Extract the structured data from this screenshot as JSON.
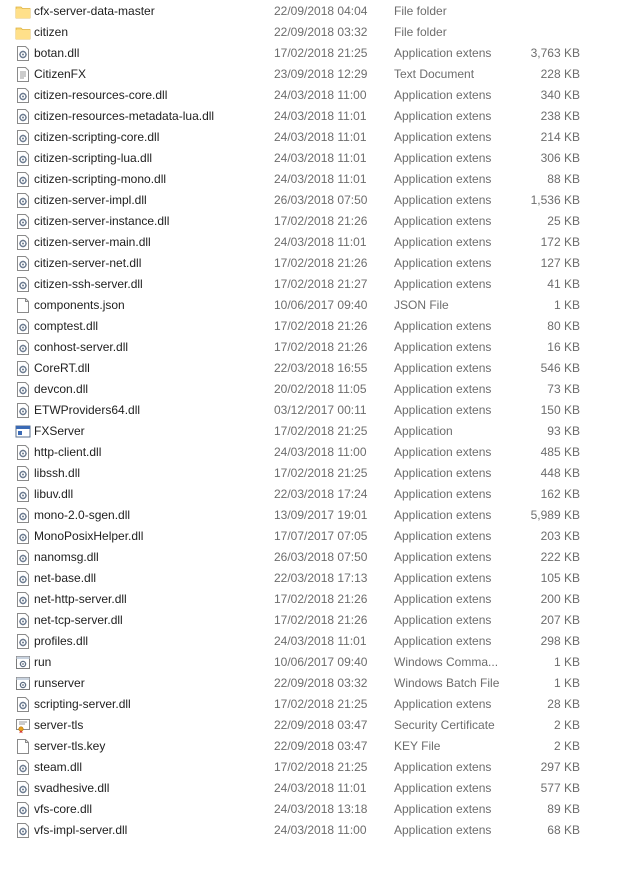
{
  "files": [
    {
      "name": "cfx-server-data-master",
      "date": "22/09/2018 04:04",
      "type": "File folder",
      "size": "",
      "icon": "folder-icon"
    },
    {
      "name": "citizen",
      "date": "22/09/2018 03:32",
      "type": "File folder",
      "size": "",
      "icon": "folder-icon"
    },
    {
      "name": "botan.dll",
      "date": "17/02/2018 21:25",
      "type": "Application extens",
      "size": "3,763 KB",
      "icon": "dll-icon"
    },
    {
      "name": "CitizenFX",
      "date": "23/09/2018 12:29",
      "type": "Text Document",
      "size": "228 KB",
      "icon": "text-document-icon"
    },
    {
      "name": "citizen-resources-core.dll",
      "date": "24/03/2018 11:00",
      "type": "Application extens",
      "size": "340 KB",
      "icon": "dll-icon"
    },
    {
      "name": "citizen-resources-metadata-lua.dll",
      "date": "24/03/2018 11:01",
      "type": "Application extens",
      "size": "238 KB",
      "icon": "dll-icon"
    },
    {
      "name": "citizen-scripting-core.dll",
      "date": "24/03/2018 11:01",
      "type": "Application extens",
      "size": "214 KB",
      "icon": "dll-icon"
    },
    {
      "name": "citizen-scripting-lua.dll",
      "date": "24/03/2018 11:01",
      "type": "Application extens",
      "size": "306 KB",
      "icon": "dll-icon"
    },
    {
      "name": "citizen-scripting-mono.dll",
      "date": "24/03/2018 11:01",
      "type": "Application extens",
      "size": "88 KB",
      "icon": "dll-icon"
    },
    {
      "name": "citizen-server-impl.dll",
      "date": "26/03/2018 07:50",
      "type": "Application extens",
      "size": "1,536 KB",
      "icon": "dll-icon"
    },
    {
      "name": "citizen-server-instance.dll",
      "date": "17/02/2018 21:26",
      "type": "Application extens",
      "size": "25 KB",
      "icon": "dll-icon"
    },
    {
      "name": "citizen-server-main.dll",
      "date": "24/03/2018 11:01",
      "type": "Application extens",
      "size": "172 KB",
      "icon": "dll-icon"
    },
    {
      "name": "citizen-server-net.dll",
      "date": "17/02/2018 21:26",
      "type": "Application extens",
      "size": "127 KB",
      "icon": "dll-icon"
    },
    {
      "name": "citizen-ssh-server.dll",
      "date": "17/02/2018 21:27",
      "type": "Application extens",
      "size": "41 KB",
      "icon": "dll-icon"
    },
    {
      "name": "components.json",
      "date": "10/06/2017 09:40",
      "type": "JSON File",
      "size": "1 KB",
      "icon": "blank-file-icon"
    },
    {
      "name": "comptest.dll",
      "date": "17/02/2018 21:26",
      "type": "Application extens",
      "size": "80 KB",
      "icon": "dll-icon"
    },
    {
      "name": "conhost-server.dll",
      "date": "17/02/2018 21:26",
      "type": "Application extens",
      "size": "16 KB",
      "icon": "dll-icon"
    },
    {
      "name": "CoreRT.dll",
      "date": "22/03/2018 16:55",
      "type": "Application extens",
      "size": "546 KB",
      "icon": "dll-icon"
    },
    {
      "name": "devcon.dll",
      "date": "20/02/2018 11:05",
      "type": "Application extens",
      "size": "73 KB",
      "icon": "dll-icon"
    },
    {
      "name": "ETWProviders64.dll",
      "date": "03/12/2017 00:11",
      "type": "Application extens",
      "size": "150 KB",
      "icon": "dll-icon"
    },
    {
      "name": "FXServer",
      "date": "17/02/2018 21:25",
      "type": "Application",
      "size": "93 KB",
      "icon": "application-icon"
    },
    {
      "name": "http-client.dll",
      "date": "24/03/2018 11:00",
      "type": "Application extens",
      "size": "485 KB",
      "icon": "dll-icon"
    },
    {
      "name": "libssh.dll",
      "date": "17/02/2018 21:25",
      "type": "Application extens",
      "size": "448 KB",
      "icon": "dll-icon"
    },
    {
      "name": "libuv.dll",
      "date": "22/03/2018 17:24",
      "type": "Application extens",
      "size": "162 KB",
      "icon": "dll-icon"
    },
    {
      "name": "mono-2.0-sgen.dll",
      "date": "13/09/2017 19:01",
      "type": "Application extens",
      "size": "5,989 KB",
      "icon": "dll-icon"
    },
    {
      "name": "MonoPosixHelper.dll",
      "date": "17/07/2017 07:05",
      "type": "Application extens",
      "size": "203 KB",
      "icon": "dll-icon"
    },
    {
      "name": "nanomsg.dll",
      "date": "26/03/2018 07:50",
      "type": "Application extens",
      "size": "222 KB",
      "icon": "dll-icon"
    },
    {
      "name": "net-base.dll",
      "date": "22/03/2018 17:13",
      "type": "Application extens",
      "size": "105 KB",
      "icon": "dll-icon"
    },
    {
      "name": "net-http-server.dll",
      "date": "17/02/2018 21:26",
      "type": "Application extens",
      "size": "200 KB",
      "icon": "dll-icon"
    },
    {
      "name": "net-tcp-server.dll",
      "date": "17/02/2018 21:26",
      "type": "Application extens",
      "size": "207 KB",
      "icon": "dll-icon"
    },
    {
      "name": "profiles.dll",
      "date": "24/03/2018 11:01",
      "type": "Application extens",
      "size": "298 KB",
      "icon": "dll-icon"
    },
    {
      "name": "run",
      "date": "10/06/2017 09:40",
      "type": "Windows Comma...",
      "size": "1 KB",
      "icon": "batch-file-icon"
    },
    {
      "name": "runserver",
      "date": "22/09/2018 03:32",
      "type": "Windows Batch File",
      "size": "1 KB",
      "icon": "batch-file-icon"
    },
    {
      "name": "scripting-server.dll",
      "date": "17/02/2018 21:25",
      "type": "Application extens",
      "size": "28 KB",
      "icon": "dll-icon"
    },
    {
      "name": "server-tls",
      "date": "22/09/2018 03:47",
      "type": "Security Certificate",
      "size": "2 KB",
      "icon": "certificate-icon"
    },
    {
      "name": "server-tls.key",
      "date": "22/09/2018 03:47",
      "type": "KEY File",
      "size": "2 KB",
      "icon": "blank-file-icon"
    },
    {
      "name": "steam.dll",
      "date": "17/02/2018 21:25",
      "type": "Application extens",
      "size": "297 KB",
      "icon": "dll-icon"
    },
    {
      "name": "svadhesive.dll",
      "date": "24/03/2018 11:01",
      "type": "Application extens",
      "size": "577 KB",
      "icon": "dll-icon"
    },
    {
      "name": "vfs-core.dll",
      "date": "24/03/2018 13:18",
      "type": "Application extens",
      "size": "89 KB",
      "icon": "dll-icon"
    },
    {
      "name": "vfs-impl-server.dll",
      "date": "24/03/2018 11:00",
      "type": "Application extens",
      "size": "68 KB",
      "icon": "dll-icon"
    }
  ]
}
